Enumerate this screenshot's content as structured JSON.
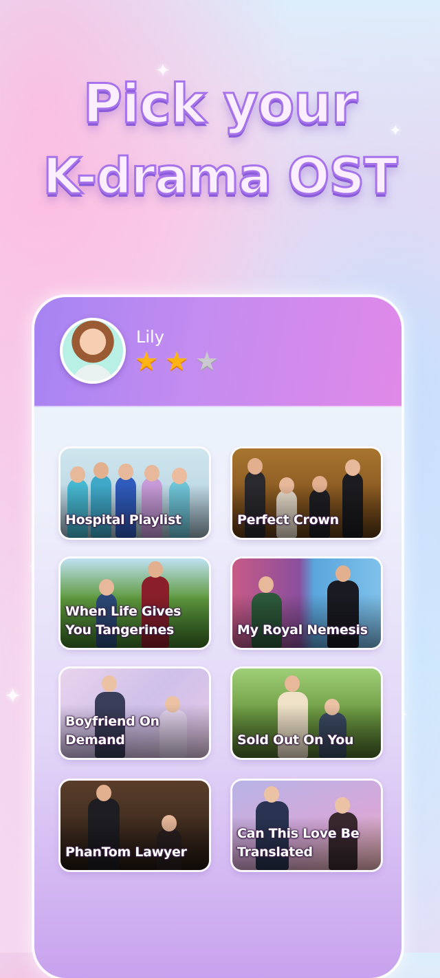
{
  "headline": {
    "line1": "Pick your",
    "line2": "K-drama OST"
  },
  "profile": {
    "name": "Lily",
    "rating": 2,
    "rating_max": 3
  },
  "dramas": [
    {
      "title": "Hospital Playlist",
      "icon": "hospital-playlist-thumbnail"
    },
    {
      "title": "Perfect Crown",
      "icon": "perfect-crown-thumbnail"
    },
    {
      "title": "When Life Gives You Tangerines",
      "icon": "tangerines-thumbnail"
    },
    {
      "title": "My Royal Nemesis",
      "icon": "royal-nemesis-thumbnail"
    },
    {
      "title": "Boyfriend On Demand",
      "icon": "boyfriend-on-demand-thumbnail"
    },
    {
      "title": "Sold Out On You",
      "icon": "sold-out-on-you-thumbnail"
    },
    {
      "title": "PhanTom Lawyer",
      "icon": "phantom-lawyer-thumbnail"
    },
    {
      "title": "Can This Love Be Translated",
      "icon": "can-this-love-thumbnail"
    }
  ],
  "colors": {
    "accent": "#a773ea",
    "header_start": "#a684f2",
    "header_end": "#e089e8",
    "star_on": "#ffb312",
    "star_off": "#c9c9cf"
  }
}
